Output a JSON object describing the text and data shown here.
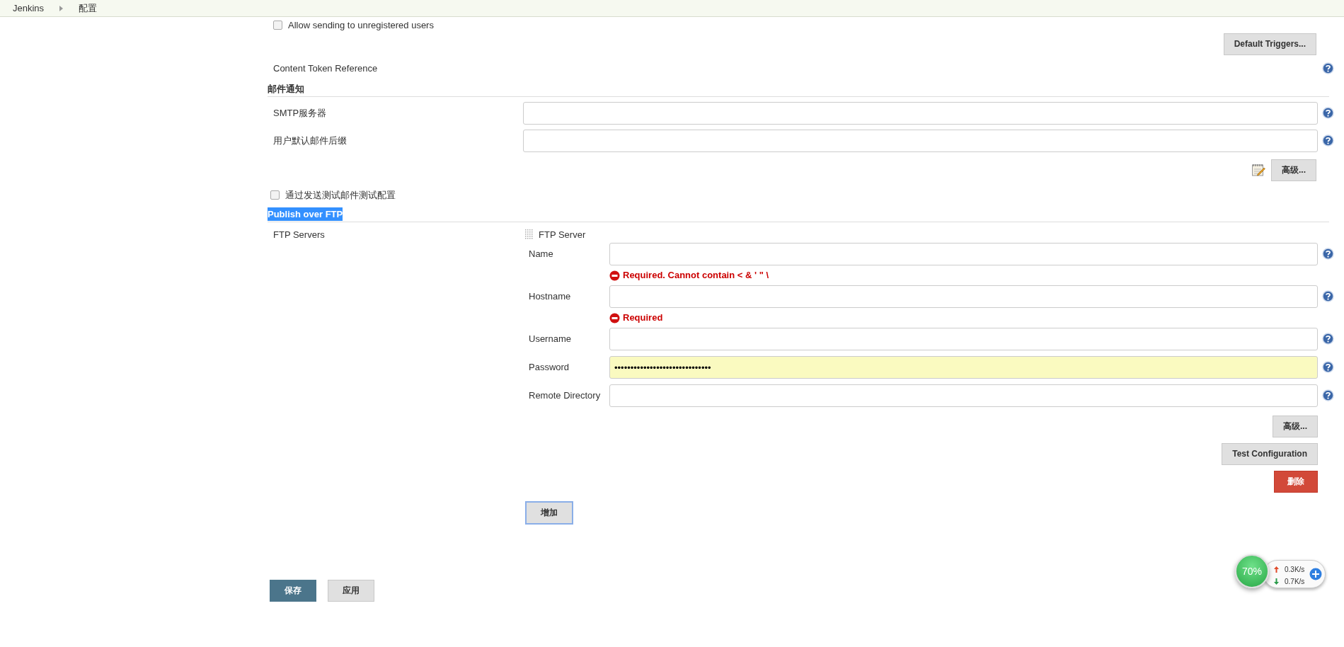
{
  "breadcrumbs": [
    {
      "label": "Jenkins"
    },
    {
      "label": "配置"
    }
  ],
  "top_checkbox": {
    "label": "Allow sending to unregistered users",
    "checked": false
  },
  "default_triggers_button": "Default Triggers...",
  "content_token": {
    "label": "Content Token Reference"
  },
  "email_section": {
    "title": "邮件通知",
    "fields": [
      {
        "label": "SMTP服务器"
      },
      {
        "label": "用户默认邮件后缀"
      }
    ],
    "advanced_button": "高级..."
  },
  "test_checkbox": {
    "label": "通过发送测试邮件测试配置",
    "checked": false
  },
  "ftp_section": {
    "title": "Publish over FTP",
    "highlighted": true,
    "servers_label": "FTP Servers",
    "server": {
      "title": "FTP Server",
      "fields": [
        {
          "label": "Name",
          "kind": "text",
          "error": "Required. Cannot contain < & ' \" \\"
        },
        {
          "label": "Hostname",
          "kind": "text",
          "error": "Required"
        },
        {
          "label": "Username",
          "kind": "text"
        },
        {
          "label": "Password",
          "kind": "password",
          "value": "••••••••••••••••••••••••••••••"
        },
        {
          "label": "Remote Directory",
          "kind": "text"
        }
      ],
      "buttons": [
        {
          "label": "高级...",
          "kind": "default"
        },
        {
          "label": "Test Configuration",
          "kind": "default"
        },
        {
          "label": "删除",
          "kind": "danger"
        }
      ]
    },
    "add_button": {
      "label": "增加",
      "focused": true
    }
  },
  "actions": [
    {
      "label": "保存",
      "kind": "primary"
    },
    {
      "label": "应用",
      "kind": "default"
    }
  ],
  "speed_widget": {
    "percent": "70%",
    "upload": "0.3K/s",
    "download": "0.7K/s"
  }
}
